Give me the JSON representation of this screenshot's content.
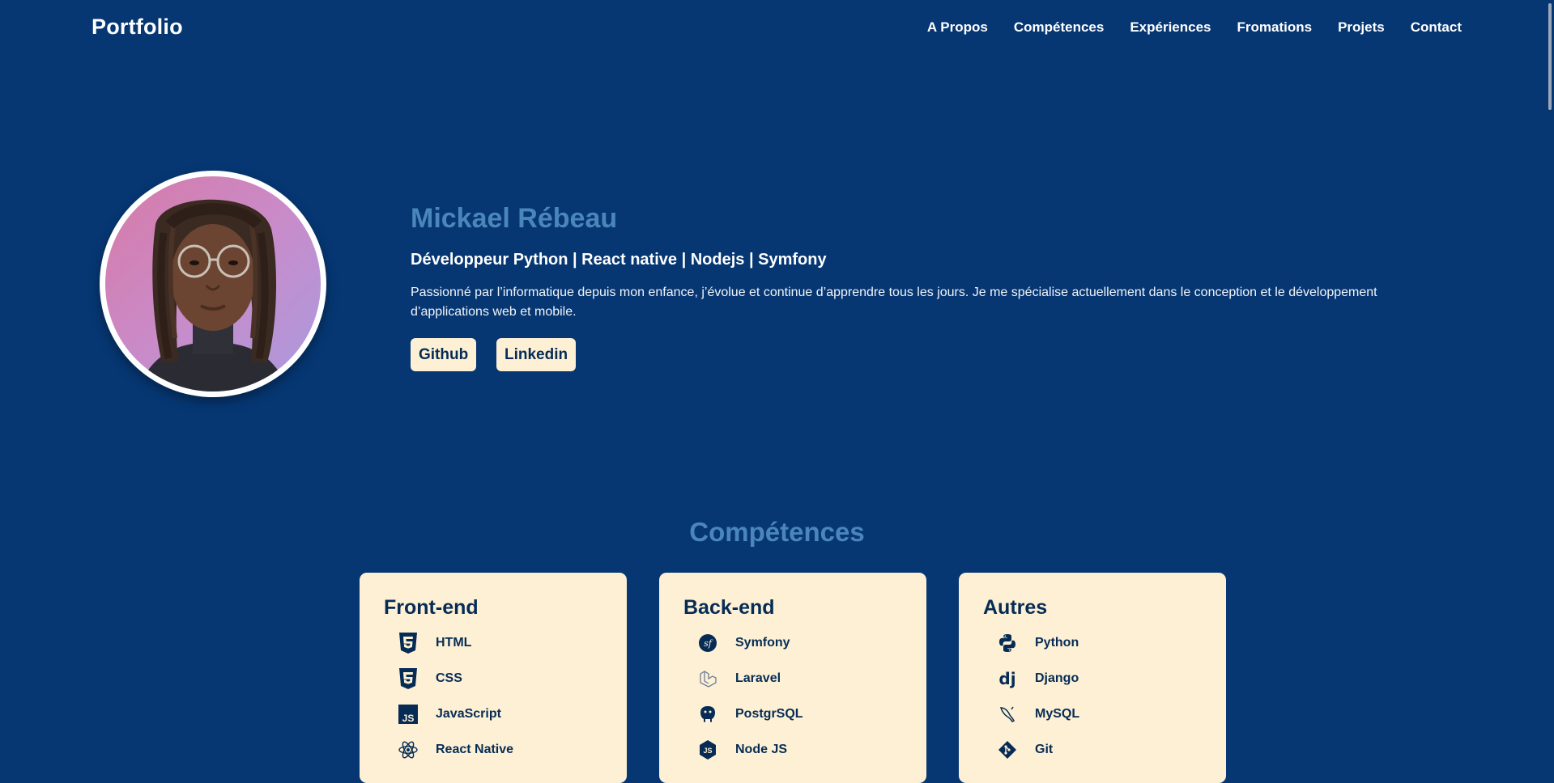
{
  "brand": "Portfolio",
  "nav": [
    "A Propos",
    "Compétences",
    "Expériences",
    "Fromations",
    "Projets",
    "Contact"
  ],
  "hero": {
    "name": "Mickael Rébeau",
    "subtitle": "Développeur Python | React native | Nodejs | Symfony",
    "description": "Passionné par l’informatique depuis mon enfance, j’évolue et continue d’apprendre tous les jours. Je me spécialise actuellement dans le conception et le développement d’applications web et mobile.",
    "buttons": {
      "github": "Github",
      "linkedin": "Linkedin"
    }
  },
  "skills": {
    "title": "Compétences",
    "cards": [
      {
        "title": "Front-end",
        "items": [
          {
            "label": "HTML",
            "icon": "html5-icon"
          },
          {
            "label": "CSS",
            "icon": "css3-icon"
          },
          {
            "label": "JavaScript",
            "icon": "javascript-icon"
          },
          {
            "label": "React Native",
            "icon": "react-icon"
          }
        ]
      },
      {
        "title": "Back-end",
        "items": [
          {
            "label": "Symfony",
            "icon": "symfony-icon"
          },
          {
            "label": "Laravel",
            "icon": "laravel-icon"
          },
          {
            "label": "PostgrSQL",
            "icon": "postgresql-icon"
          },
          {
            "label": "Node JS",
            "icon": "nodejs-icon"
          }
        ]
      },
      {
        "title": "Autres",
        "items": [
          {
            "label": "Python",
            "icon": "python-icon"
          },
          {
            "label": "Django",
            "icon": "django-icon"
          },
          {
            "label": "MySQL",
            "icon": "mysql-icon"
          },
          {
            "label": "Git",
            "icon": "git-icon"
          }
        ]
      }
    ]
  },
  "colors": {
    "background": "#063773",
    "accent": "#4b86ba",
    "card": "#fdf0d5",
    "card_text": "#062c55"
  }
}
